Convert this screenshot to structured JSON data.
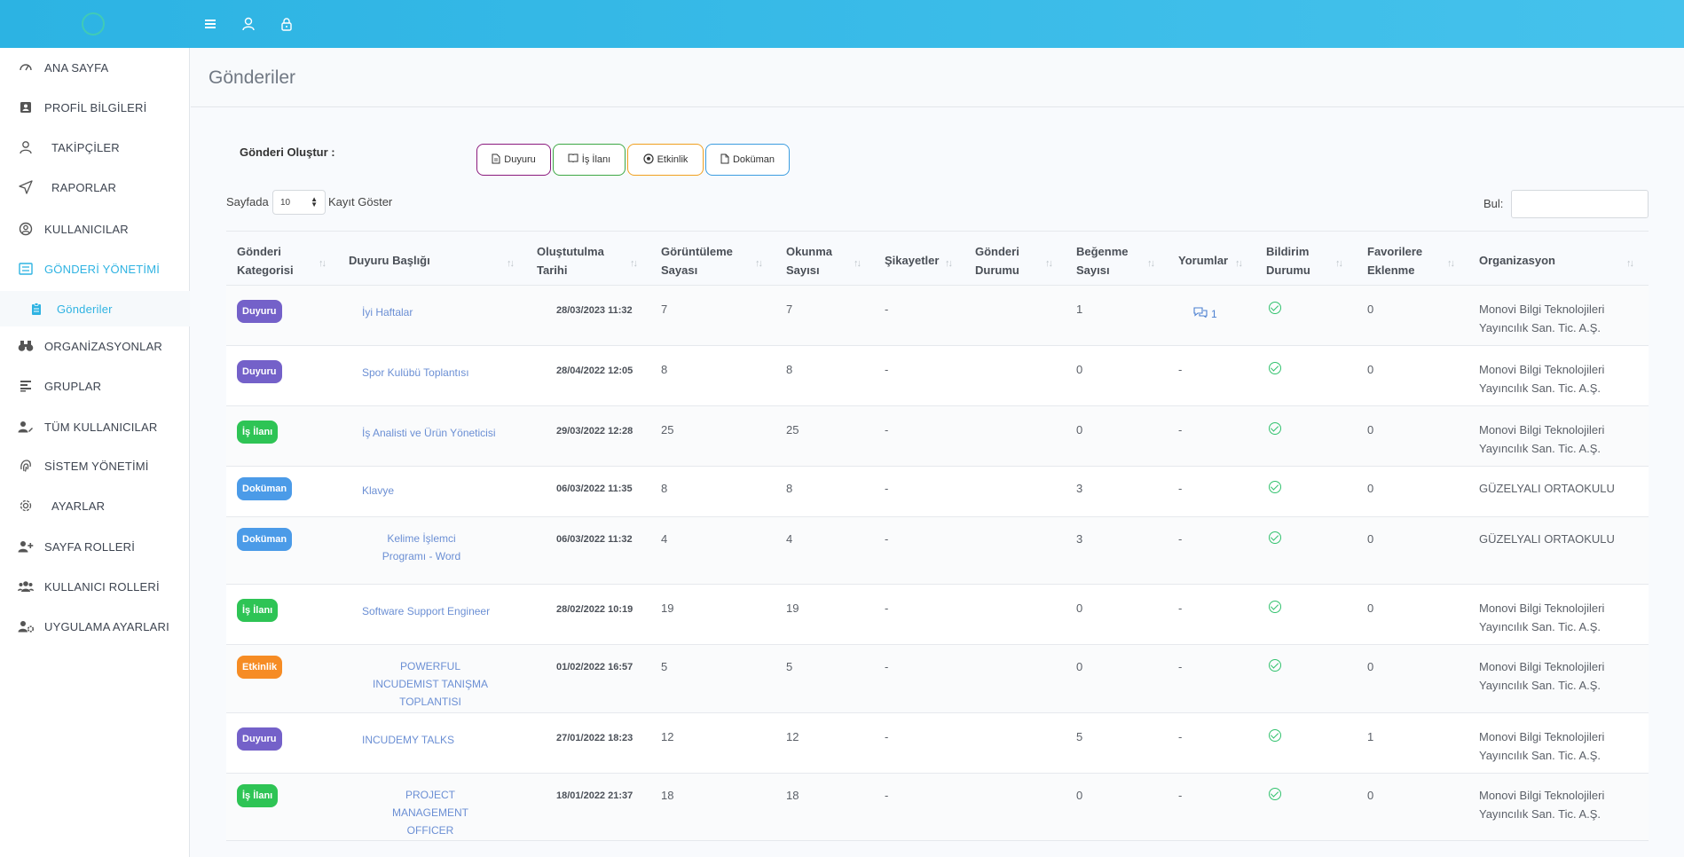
{
  "topbar": {
    "icons": [
      "menu-icon",
      "user-icon",
      "lock-icon"
    ]
  },
  "sidebar": {
    "items": [
      {
        "label": "ANA SAYFA",
        "icon": "dashboard-icon"
      },
      {
        "label": "PROFİL BİLGİLERİ",
        "icon": "profile-card-icon"
      },
      {
        "label": "TAKİPÇİLER",
        "icon": "user-icon"
      },
      {
        "label": "RAPORLAR",
        "icon": "send-icon"
      },
      {
        "label": "KULLANICILAR",
        "icon": "user-circle-icon"
      },
      {
        "label": "GÖNDERİ YÖNETİMİ",
        "icon": "list-icon",
        "active": true
      },
      {
        "label": "Gönderiler",
        "icon": "clipboard-icon",
        "sub": true
      },
      {
        "label": "ORGANİZASYONLAR",
        "icon": "binoculars-icon"
      },
      {
        "label": "GRUPLAR",
        "icon": "bars-icon"
      },
      {
        "label": "TÜM KULLANICILAR",
        "icon": "user-edit-icon"
      },
      {
        "label": "SİSTEM YÖNETİMİ",
        "icon": "fingerprint-icon"
      },
      {
        "label": "AYARLAR",
        "icon": "gear-icon"
      },
      {
        "label": "SAYFA ROLLERİ",
        "icon": "user-plus-icon"
      },
      {
        "label": "KULLANICI ROLLERİ",
        "icon": "users-icon"
      },
      {
        "label": "UYGULAMA AYARLARI",
        "icon": "user-cog-icon"
      }
    ]
  },
  "page": {
    "title": "Gönderiler",
    "create_label": "Gönderi Oluştur :",
    "create_buttons": [
      {
        "label": "Duyuru",
        "color": "#8b1a7e",
        "icon": "document-icon"
      },
      {
        "label": "İş İlanı",
        "color": "#3ea845",
        "icon": "book-icon"
      },
      {
        "label": "Etkinlik",
        "color": "#f0a020",
        "icon": "soccer-icon"
      },
      {
        "label": "Doküman",
        "color": "#3c9de0",
        "icon": "file-icon"
      }
    ],
    "length_prefix": "Sayfada",
    "length_value": "10",
    "length_suffix": "Kayıt Göster",
    "search_label": "Bul:",
    "search_value": ""
  },
  "table": {
    "headers": [
      "Gönderi\nKategorisi",
      "Duyuru Başlığı",
      "Oluştutulma\nTarihi",
      "Görüntüleme\nSayası",
      "Okunma\nSayısı",
      "Şikayetler",
      "Gönderi\nDurumu",
      "Beğenme\nSayısı",
      "Yorumlar",
      "Bildirim\nDurumu",
      "Favorilere\nEklenme",
      "Organizasyon"
    ],
    "rows": [
      {
        "category": "Duyuru",
        "cat_color": "#7461c9",
        "title": "İyi Haftalar",
        "date": "28/03/2023 11:32",
        "views": "7",
        "reads": "7",
        "complaints": "-",
        "likes": "1",
        "comments": "1",
        "favorites": "0",
        "org": "Monovi Bilgi Teknolojileri Yayıncılık San. Tic. A.Ş."
      },
      {
        "category": "Duyuru",
        "cat_color": "#7461c9",
        "title": "Spor Kulübü Toplantısı",
        "date": "28/04/2022 12:05",
        "views": "8",
        "reads": "8",
        "complaints": "-",
        "likes": "0",
        "comments": "-",
        "favorites": "0",
        "org": "Monovi Bilgi Teknolojileri Yayıncılık San. Tic. A.Ş."
      },
      {
        "category": "İş İlanı",
        "cat_color": "#2ec455",
        "title": "İş Analisti ve Ürün Yöneticisi",
        "date": "29/03/2022 12:28",
        "views": "25",
        "reads": "25",
        "complaints": "-",
        "likes": "0",
        "comments": "-",
        "favorites": "0",
        "org": "Monovi Bilgi Teknolojileri Yayıncılık San. Tic. A.Ş."
      },
      {
        "category": "Doküman",
        "cat_color": "#4b9be8",
        "title": "Klavye",
        "date": "06/03/2022 11:35",
        "views": "8",
        "reads": "8",
        "complaints": "-",
        "likes": "3",
        "comments": "-",
        "favorites": "0",
        "org": "GÜZELYALI ORTAOKULU"
      },
      {
        "category": "Doküman",
        "cat_color": "#4b9be8",
        "title": "Kelime İşlemci Programı - Word",
        "date": "06/03/2022 11:32",
        "views": "4",
        "reads": "4",
        "complaints": "-",
        "likes": "3",
        "comments": "-",
        "favorites": "0",
        "org": "GÜZELYALI ORTAOKULU"
      },
      {
        "category": "İş İlanı",
        "cat_color": "#2ec455",
        "title": "Software Support Engineer",
        "date": "28/02/2022 10:19",
        "views": "19",
        "reads": "19",
        "complaints": "-",
        "likes": "0",
        "comments": "-",
        "favorites": "0",
        "org": "Monovi Bilgi Teknolojileri Yayıncılık San. Tic. A.Ş."
      },
      {
        "category": "Etkinlik",
        "cat_color": "#f68c24",
        "title": "POWERFUL INCUDEMIST TANIŞMA TOPLANTISI",
        "date": "01/02/2022 16:57",
        "views": "5",
        "reads": "5",
        "complaints": "-",
        "likes": "0",
        "comments": "-",
        "favorites": "0",
        "org": "Monovi Bilgi Teknolojileri Yayıncılık San. Tic. A.Ş."
      },
      {
        "category": "Duyuru",
        "cat_color": "#7461c9",
        "title": "INCUDEMY TALKS",
        "date": "27/01/2022 18:23",
        "views": "12",
        "reads": "12",
        "complaints": "-",
        "likes": "5",
        "comments": "-",
        "favorites": "1",
        "org": "Monovi Bilgi Teknolojileri Yayıncılık San. Tic. A.Ş."
      },
      {
        "category": "İş İlanı",
        "cat_color": "#2ec455",
        "title": "PROJECT MANAGEMENT OFFICER",
        "date": "18/01/2022 21:37",
        "views": "18",
        "reads": "18",
        "complaints": "-",
        "likes": "0",
        "comments": "-",
        "favorites": "0",
        "org": "Monovi Bilgi Teknolojileri Yayıncılık San. Tic. A.Ş."
      }
    ]
  }
}
